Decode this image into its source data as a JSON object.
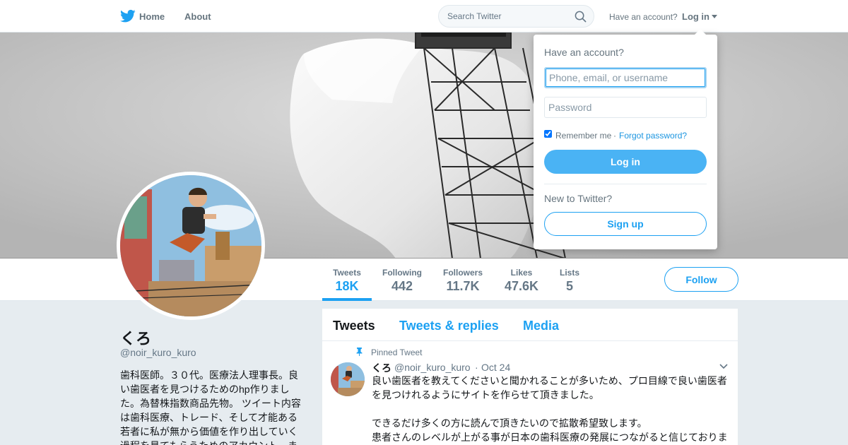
{
  "topnav": {
    "home_label": "Home",
    "about_label": "About",
    "search_placeholder": "Search Twitter",
    "have_account": "Have an account?",
    "login_label": "Log in"
  },
  "brand": {
    "accent": "#1da1f2",
    "icon": "twitter-bird-icon"
  },
  "profile": {
    "name": "くろ",
    "handle": "@noir_kuro_kuro",
    "bio": "歯科医師。３０代。医療法人理事長。良い歯医者を見つけるためのhp作りました。為替株指数商品先物。 ツイート内容は歯科医療、トレード、そして才能ある若者に私が無から価値を作り出していく過程を見てもらうためのアカウント。ま"
  },
  "stats": [
    {
      "label": "Tweets",
      "value": "18K",
      "active": true
    },
    {
      "label": "Following",
      "value": "442"
    },
    {
      "label": "Followers",
      "value": "11.7K"
    },
    {
      "label": "Likes",
      "value": "47.6K"
    },
    {
      "label": "Lists",
      "value": "5"
    }
  ],
  "follow_label": "Follow",
  "timeline": {
    "tabs": [
      "Tweets",
      "Tweets & replies",
      "Media"
    ],
    "pinned_label": "Pinned Tweet",
    "tweet": {
      "name": "くろ",
      "handle": "@noir_kuro_kuro",
      "separator": "·",
      "time": "Oct 24",
      "text": "良い歯医者を教えてくださいと聞かれることが多いため、プロ目線で良い歯医者を見つけれるようにサイトを作らせて頂きました。\n\nできるだけ多くの方に読んで頂きたいので拡散希望致します。\n患者さんのレベルが上がる事が日本の歯科医療の発展につながると信じておりま"
    }
  },
  "login_dropdown": {
    "title": "Have an account?",
    "username_placeholder": "Phone, email, or username",
    "password_placeholder": "Password",
    "remember_label": "Remember me",
    "remember_checked": true,
    "separator": "·",
    "forgot_label": "Forgot password?",
    "login_button": "Log in",
    "new_to": "New to Twitter?",
    "signup_button": "Sign up"
  }
}
